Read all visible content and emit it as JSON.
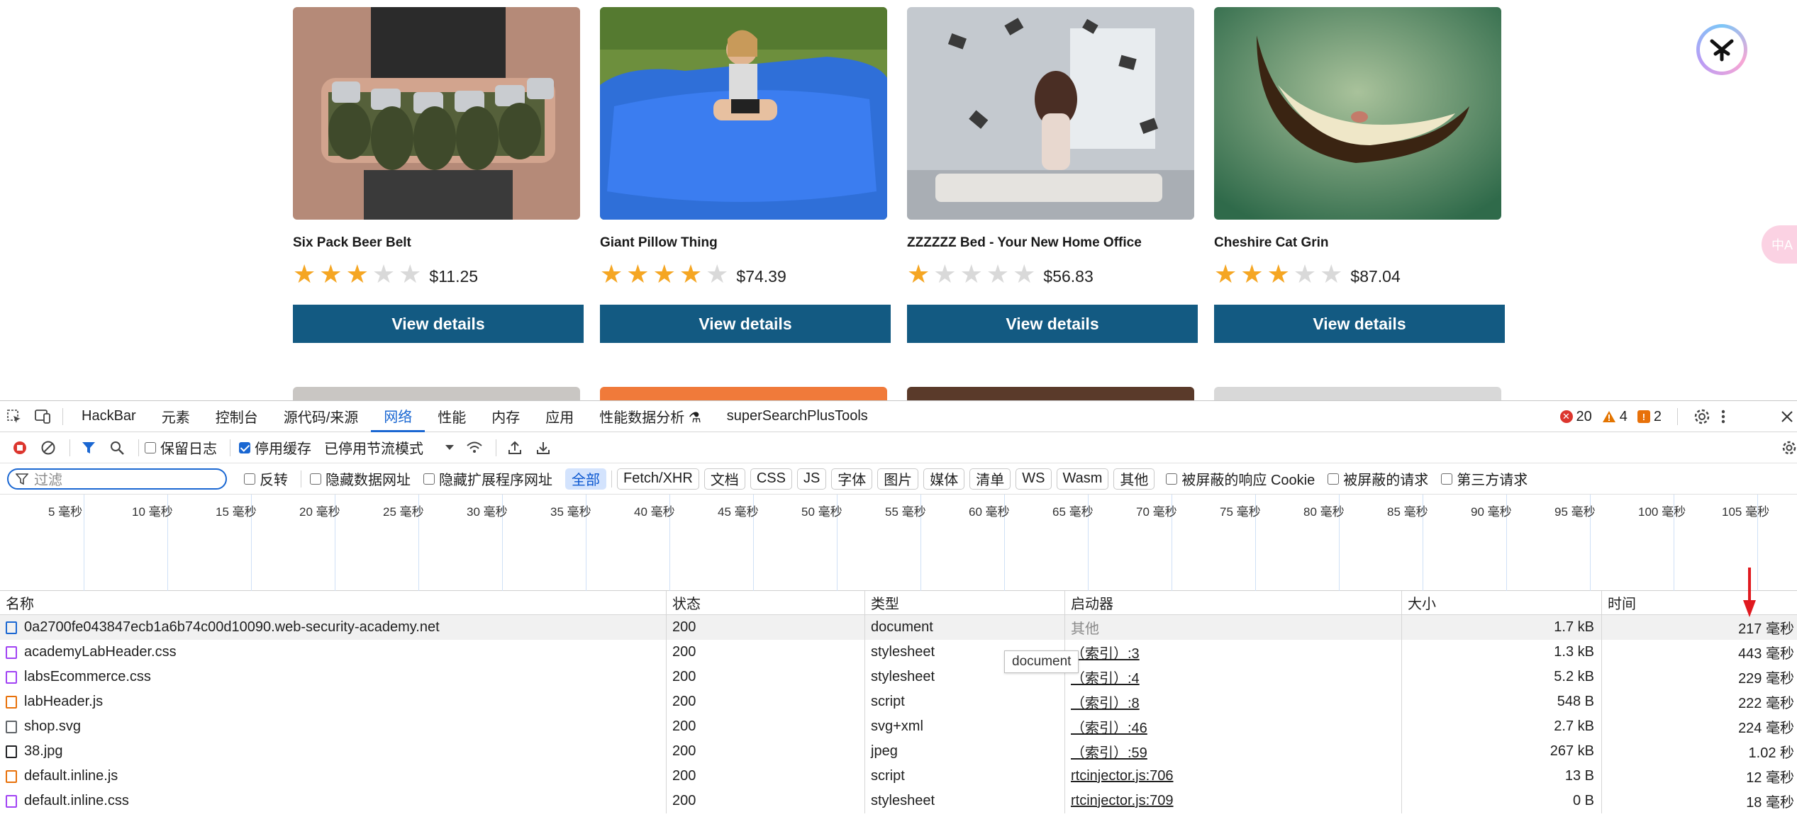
{
  "products": [
    {
      "name": "Six Pack Beer Belt",
      "rating": 3,
      "price": "$11.25",
      "button": "View details"
    },
    {
      "name": "Giant Pillow Thing",
      "rating": 4,
      "price": "$74.39",
      "button": "View details"
    },
    {
      "name": "ZZZZZZ Bed - Your New Home Office",
      "rating": 1,
      "price": "$56.83",
      "button": "View details"
    },
    {
      "name": "Cheshire Cat Grin",
      "rating": 3,
      "price": "$87.04",
      "button": "View details"
    }
  ],
  "translate_pill": "中A",
  "devtools": {
    "tabs": [
      "HackBar",
      "元素",
      "控制台",
      "源代码/来源",
      "网络",
      "性能",
      "内存",
      "应用",
      "性能数据分析 ⚗",
      "superSearchPlusTools"
    ],
    "active_tab": "网络",
    "counts": {
      "errors": "20",
      "warnings": "4",
      "issues": "2"
    },
    "toolbar": {
      "preserve_log": "保留日志",
      "disable_cache": "停用缓存",
      "throttling": "已停用节流模式"
    },
    "filter": {
      "placeholder": "过滤",
      "invert": "反转",
      "hide_data_urls": "隐藏数据网址",
      "hide_ext_urls": "隐藏扩展程序网址",
      "types": [
        "全部",
        "Fetch/XHR",
        "文档",
        "CSS",
        "JS",
        "字体",
        "图片",
        "媒体",
        "清单",
        "WS",
        "Wasm",
        "其他"
      ],
      "active_type": "全部",
      "blocked_cookies": "被屏蔽的响应 Cookie",
      "blocked_requests": "被屏蔽的请求",
      "third_party": "第三方请求"
    },
    "timeline_ticks": [
      "5 毫秒",
      "10 毫秒",
      "15 毫秒",
      "20 毫秒",
      "25 毫秒",
      "30 毫秒",
      "35 毫秒",
      "40 毫秒",
      "45 毫秒",
      "50 毫秒",
      "55 毫秒",
      "60 毫秒",
      "65 毫秒",
      "70 毫秒",
      "75 毫秒",
      "80 毫秒",
      "85 毫秒",
      "90 毫秒",
      "95 毫秒",
      "100 毫秒",
      "105 毫秒"
    ],
    "columns": {
      "name": "名称",
      "status": "状态",
      "type": "类型",
      "initiator": "启动器",
      "size": "大小",
      "time": "时间"
    },
    "rows": [
      {
        "name": "0a2700fe043847ecb1a6b74c00d10090.web-security-academy.net",
        "status": "200",
        "type": "document",
        "initiator": "其他",
        "size": "1.7 kB",
        "time": "217 毫秒",
        "icon": "document-icon"
      },
      {
        "name": "academyLabHeader.css",
        "status": "200",
        "type": "stylesheet",
        "initiator": "（索引）:3",
        "size": "1.3 kB",
        "time": "443 毫秒",
        "icon": "css-file-icon"
      },
      {
        "name": "labsEcommerce.css",
        "status": "200",
        "type": "stylesheet",
        "initiator": "（索引）:4",
        "size": "5.2 kB",
        "time": "229 毫秒",
        "icon": "css-file-icon"
      },
      {
        "name": "labHeader.js",
        "status": "200",
        "type": "script",
        "initiator": "（索引）:8",
        "size": "548 B",
        "time": "222 毫秒",
        "icon": "script-file-icon"
      },
      {
        "name": "shop.svg",
        "status": "200",
        "type": "svg+xml",
        "initiator": "（索引）:46",
        "size": "2.7 kB",
        "time": "224 毫秒",
        "icon": "svg-file-icon"
      },
      {
        "name": "38.jpg",
        "status": "200",
        "type": "jpeg",
        "initiator": "（索引）:59",
        "size": "267 kB",
        "time": "1.02 秒",
        "icon": "image-file-icon"
      },
      {
        "name": "default.inline.js",
        "status": "200",
        "type": "script",
        "initiator": "rtcinjector.js:706",
        "size": "13 B",
        "time": "12 毫秒",
        "icon": "script-file-icon"
      },
      {
        "name": "default.inline.css",
        "status": "200",
        "type": "stylesheet",
        "initiator": "rtcinjector.js:709",
        "size": "0 B",
        "time": "18 毫秒",
        "icon": "css-file-icon"
      }
    ],
    "tooltip": "document"
  }
}
